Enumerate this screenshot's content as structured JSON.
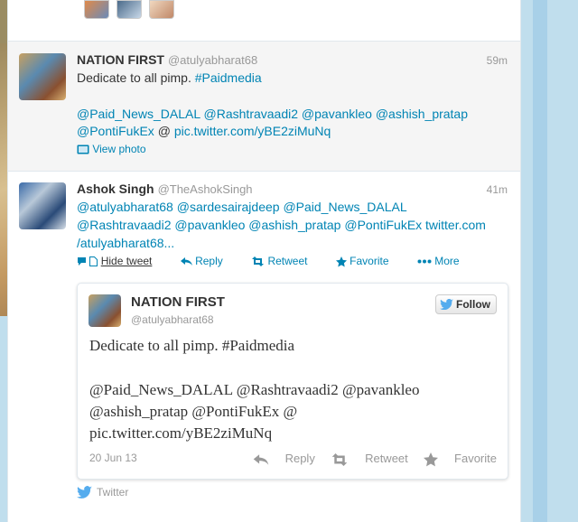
{
  "colors": {
    "link": "#0084b4",
    "muted": "#999999",
    "text": "#333333",
    "page_bg": "#c0deed"
  },
  "tweet1": {
    "name": "NATION FIRST",
    "handle": "@atulyabharat68",
    "time": "59m",
    "text_plain": "Dedicate to all pimp.",
    "hashtag": "#Paidmedia",
    "mentions_line1": "@Paid_News_DALAL @Rashtravaadi2 @pavankleo @ashish_pratap",
    "mentions_line2_a": "@PontiFukEx",
    "mentions_line2_b": "@",
    "pic_link": "pic.twitter.com/yBE2ziMuNq",
    "view_photo": "View photo"
  },
  "tweet2": {
    "name": "Ashok Singh",
    "handle": "@TheAshokSingh",
    "time": "41m",
    "line1": "@atulyabharat68 @sardesairajdeep @Paid_News_DALAL",
    "line2": "@Rashtravaadi2 @pavankleo @ashish_pratap @PontiFukEx twitter.com",
    "line3": "/atulyabharat68...",
    "actions": {
      "hide": "Hide tweet",
      "reply": "Reply",
      "retweet": "Retweet",
      "favorite": "Favorite",
      "more": "More"
    }
  },
  "card": {
    "name": "NATION FIRST",
    "handle": "@atulyabharat68",
    "follow": "Follow",
    "line1": "Dedicate to all pimp. #Paidmedia",
    "line2": "@Paid_News_DALAL @Rashtravaadi2 @pavankleo",
    "line3": "@ashish_pratap @PontiFukEx @",
    "line4": "pic.twitter.com/yBE2ziMuNq",
    "date": "20 Jun 13",
    "reply": "Reply",
    "retweet": "Retweet",
    "favorite": "Favorite"
  },
  "via": "Twitter"
}
